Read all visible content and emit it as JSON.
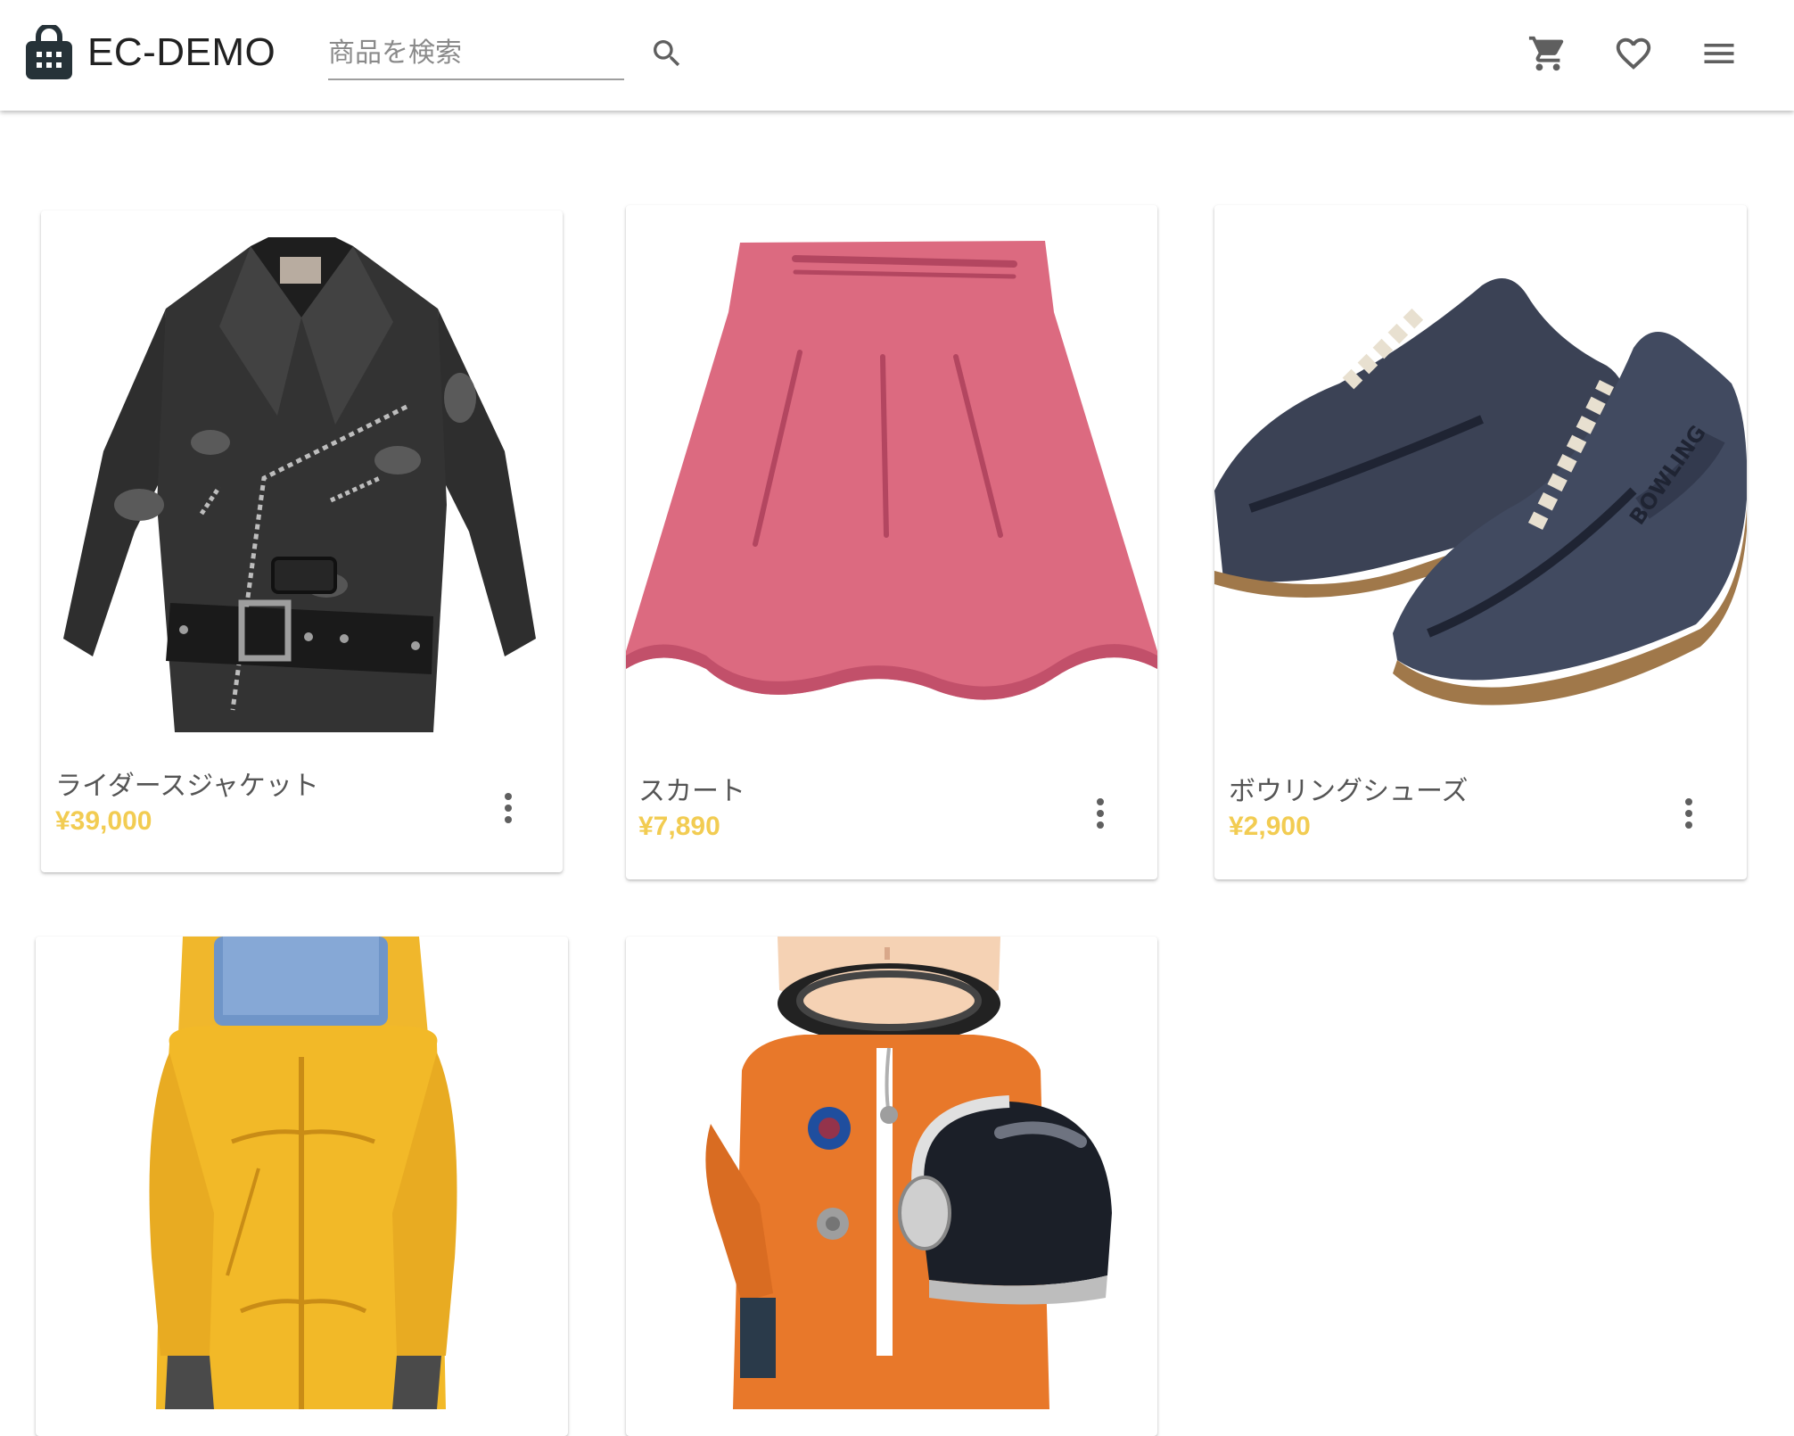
{
  "header": {
    "brand": "EC-DEMO",
    "search_placeholder": "商品を検索",
    "icons": [
      "shopping-bag-icon",
      "search-icon",
      "cart-icon",
      "heart-icon",
      "menu-icon"
    ]
  },
  "colors": {
    "price": "#f2cc52",
    "title": "#555555",
    "brand_text": "#212121"
  },
  "products": [
    {
      "name": "ライダースジャケット",
      "price": "¥39,000",
      "image": "black leather riders jacket"
    },
    {
      "name": "スカート",
      "price": "¥7,890",
      "image": "pink skirt"
    },
    {
      "name": "ボウリングシューズ",
      "price": "¥2,900",
      "image": "navy bowling shoes"
    },
    {
      "name": "",
      "price": "",
      "image": "yellow hazmat suit"
    },
    {
      "name": "",
      "price": "",
      "image": "astronaut in orange suit holding helmet"
    }
  ]
}
